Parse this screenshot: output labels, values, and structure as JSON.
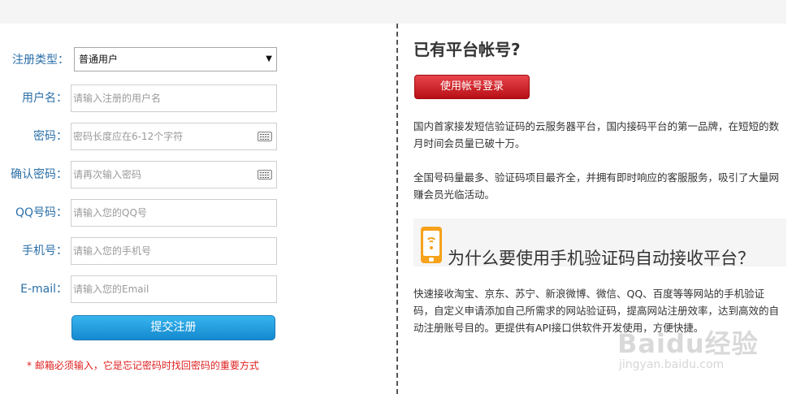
{
  "form": {
    "type_label": "注册类型：",
    "type_value": "普通用户",
    "username_label": "用户名：",
    "username_placeholder": "请输入注册的用户名",
    "password_label": "密码：",
    "password_placeholder": "密码长度应在6-12个字符",
    "confirm_label": "确认密码：",
    "confirm_placeholder": "请再次输入密码",
    "qq_label": "QQ号码：",
    "qq_placeholder": "请输入您的QQ号",
    "phone_label": "手机号：",
    "phone_placeholder": "请输入您的手机号",
    "email_label": "E-mail：",
    "email_placeholder": "请输入您的Email",
    "submit_label": "提交注册",
    "hint": "* 邮箱必须输入，它是忘记密码时找回密码的重要方式"
  },
  "side": {
    "title": "已有平台帐号?",
    "login_label": "使用帐号登录",
    "para1": "国内首家接发短信验证码的云服务器平台，国内接码平台的第一品牌，在短短的数月时间会员量已破十万。",
    "para2": "全国号码量最多、验证码项目最齐全，并拥有即时响应的客服服务，吸引了大量网赚会员光临活动。",
    "feature_title": "为什么要使用手机验证码自动接收平台？",
    "para3": "快速接收淘宝、京东、苏宁、新浪微博、微信、QQ、百度等等网站的手机验证码，自定义申请添加自己所需求的网站验证码，提高网站注册效率，达到高效的自动注册账号目的。更提供有API接口供软件开发使用，方便快捷。"
  },
  "watermark": {
    "logo": "Baidu经验",
    "url": "jingyan.baidu.com"
  },
  "colors": {
    "label_blue": "#2b6fa8",
    "submit_blue": "#1b8fd6",
    "login_red": "#c8141b",
    "hint_red": "#e02020",
    "icon_orange": "#f7a21b"
  }
}
